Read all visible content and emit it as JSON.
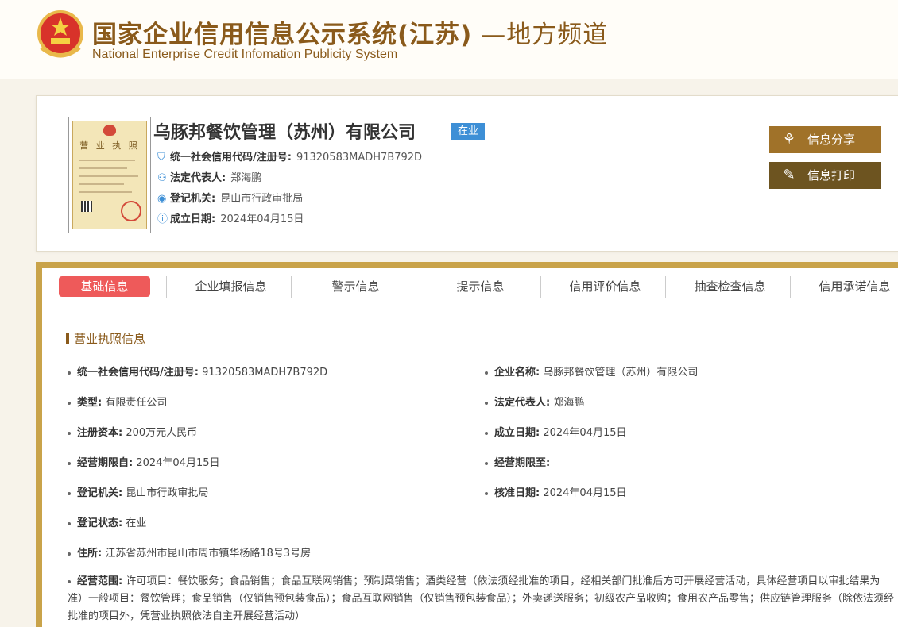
{
  "header": {
    "title_cn": "国家企业信用信息公示系统(江苏)",
    "title_suffix": " —地方频道",
    "title_en": "National Enterprise Credit Infomation Publicity System"
  },
  "company": {
    "name": "乌豚邦餐饮管理（苏州）有限公司",
    "status": "在业",
    "rows": [
      {
        "key": "统一社会信用代码/注册号:",
        "value": "91320583MADH7B792D",
        "icon": "shield-icon"
      },
      {
        "key": "法定代表人:",
        "value": "郑海鹏",
        "icon": "person-icon"
      },
      {
        "key": "登记机关:",
        "value": "昆山市行政审批局",
        "icon": "location-pin-icon"
      },
      {
        "key": "成立日期:",
        "value": "2024年04月15日",
        "icon": "info-icon"
      }
    ],
    "license_title": "营 业 执 照"
  },
  "actions": {
    "share_label": "信息分享",
    "print_label": "信息打印"
  },
  "tabs": [
    "基础信息",
    "企业填报信息",
    "警示信息",
    "提示信息",
    "信用评价信息",
    "抽查检查信息",
    "信用承诺信息"
  ],
  "section": {
    "title": "营业执照信息"
  },
  "fields_left": [
    {
      "key": "统一社会信用代码/注册号:",
      "value": "91320583MADH7B792D"
    },
    {
      "key": "类型:",
      "value": "有限责任公司"
    },
    {
      "key": "注册资本:",
      "value": "200万元人民币"
    },
    {
      "key": "经营期限自:",
      "value": "2024年04月15日"
    },
    {
      "key": "登记机关:",
      "value": "昆山市行政审批局"
    },
    {
      "key": "登记状态:",
      "value": "在业"
    },
    {
      "key": "住所:",
      "value": "江苏省苏州市昆山市周市镇华杨路18号3号房"
    }
  ],
  "fields_right": [
    {
      "key": "企业名称:",
      "value": "乌豚邦餐饮管理（苏州）有限公司"
    },
    {
      "key": "法定代表人:",
      "value": "郑海鹏"
    },
    {
      "key": "成立日期:",
      "value": "2024年04月15日"
    },
    {
      "key": "经营期限至:",
      "value": ""
    },
    {
      "key": "核准日期:",
      "value": "2024年04月15日"
    }
  ],
  "scope": {
    "key": "经营范围:",
    "value": "许可项目：餐饮服务；食品销售；食品互联网销售；预制菜销售；酒类经营（依法须经批准的项目，经相关部门批准后方可开展经营活动，具体经营项目以审批结果为准）一般项目：餐饮管理；食品销售（仅销售预包装食品）；食品互联网销售（仅销售预包装食品）；外卖递送服务；初级农产品收购；食用农产品零售；供应链管理服务（除依法须经批准的项目外，凭营业执照依法自主开展经营活动）"
  },
  "colors": {
    "brand": "#8a5a1b",
    "badge": "#3d8fd6",
    "active_tab": "#ee5a5a",
    "panel_border": "#c9a34a"
  }
}
